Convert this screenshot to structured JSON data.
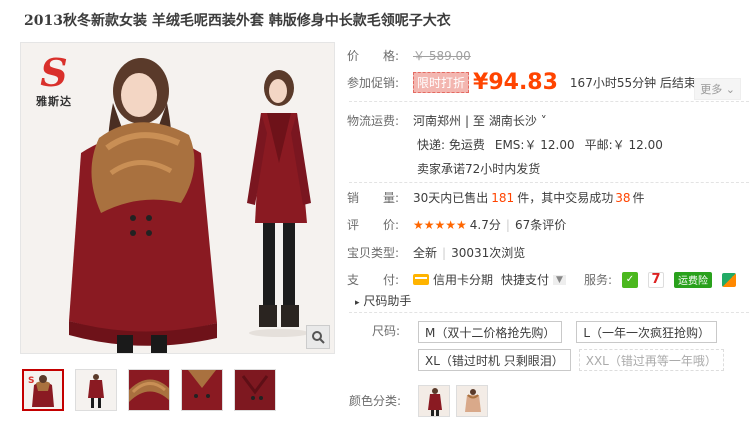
{
  "product": {
    "title": "2013秋冬新款女装 羊绒毛呢西装外套 韩版修身中长款毛领呢子大衣"
  },
  "gallery": {
    "logo_mark": "S",
    "logo_text": "雅斯达",
    "zoom_icon": "magnifier-icon",
    "thumbs_count": 5
  },
  "price": {
    "label": "价　　格:",
    "original": "￥ 589.00"
  },
  "promo": {
    "label": "参加促销:",
    "tag": "限时打折",
    "yen": "¥",
    "price": "94.83",
    "countdown": "167小时55分钟 后结束",
    "more": "更多 ⌄"
  },
  "shipping": {
    "label": "物流运费:",
    "from": "河南郑州",
    "sep": "| 至",
    "to": "湖南长沙 ˅",
    "express": "快递: 免运费",
    "ems": "EMS:￥ 12.00",
    "post": "平邮:￥ 12.00",
    "promise": "卖家承诺72小时内发货"
  },
  "sales": {
    "label": "销　　量:",
    "prefix": "30天内已售出",
    "sold": "181",
    "mid": "件，其中交易成功",
    "success": "38",
    "suffix": "件"
  },
  "rating": {
    "label": "评　　价:",
    "stars": "★★★★★",
    "score": "4.7分",
    "sep": "|",
    "reviews": "67条评价"
  },
  "type": {
    "label": "宝贝类型:",
    "value": "全新",
    "sep": "|",
    "trades": "30031次浏览"
  },
  "payment": {
    "label": "支　　付:",
    "credit": "信用卡分期",
    "quick": "快捷支付",
    "service_label": "服务:",
    "seven": "7",
    "insurance": "运费险"
  },
  "size_helper": "尺码助手",
  "sizes": {
    "label": "尺码:",
    "options": [
      "M（双十二价格抢先购）",
      "L（一年一次疯狂抢购）",
      "XL（错过时机 只剩眼泪）",
      "XXL（错过再等一年哦）"
    ]
  },
  "colors": {
    "label": "颜色分类:"
  },
  "palette": {
    "accent": "#ff4400",
    "coat": "#8a1a22",
    "fur": "#a9713f"
  }
}
